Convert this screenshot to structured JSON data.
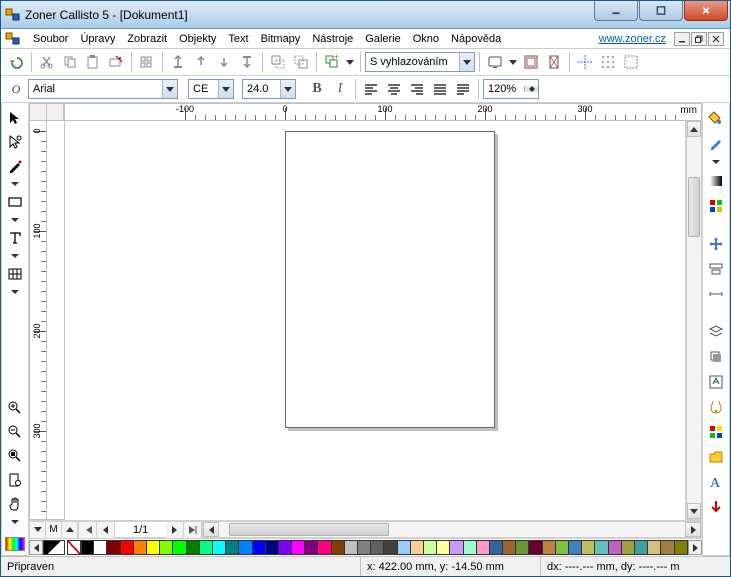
{
  "title": "Zoner Callisto 5 - [Dokument1]",
  "url": "www.zoner.cz",
  "menus": [
    "Soubor",
    "Úpravy",
    "Zobrazit",
    "Objekty",
    "Text",
    "Bitmapy",
    "Nástroje",
    "Galerie",
    "Okno",
    "Nápověda"
  ],
  "toolbar2": {
    "smoothing": "S vyhlazováním"
  },
  "formatbar": {
    "font_icon": "O",
    "font": "Arial",
    "lang": "CE",
    "size": "24.0",
    "bold": "B",
    "italic": "I",
    "zoom": "120%"
  },
  "ruler": {
    "unit": "mm",
    "h_ticks": [
      -100,
      0,
      100,
      200,
      300
    ],
    "v_ticks": [
      0,
      100,
      200,
      300
    ]
  },
  "pages": {
    "label": "1/1",
    "layer": "M"
  },
  "status": {
    "ready": "Připraven",
    "coords": "x: 422.00 mm, y: -14.50 mm",
    "delta": "dx: ----.--- mm, dy: ----.--- m"
  },
  "colors": [
    "#000000",
    "#ffffff",
    "#800000",
    "#ff0000",
    "#ff8000",
    "#ffff00",
    "#80ff00",
    "#00ff00",
    "#008000",
    "#00ff80",
    "#00ffff",
    "#008080",
    "#0080ff",
    "#0000ff",
    "#000080",
    "#8000ff",
    "#ff00ff",
    "#800080",
    "#ff0080",
    "#804000",
    "#c0c0c0",
    "#808080",
    "#606060",
    "#404040",
    "#99ccff",
    "#ffcc99",
    "#ccff99",
    "#ffff99",
    "#cc99ff",
    "#99ffcc",
    "#ff99cc",
    "#336699",
    "#996633",
    "#669933",
    "#660033",
    "#c08040",
    "#80c040",
    "#4080c0",
    "#c0c060",
    "#60c0c0",
    "#c060c0",
    "#a0a040",
    "#40a0a0",
    "#d4c080",
    "#a08040",
    "#808000"
  ],
  "well_colors": [
    "#000000",
    "#ffffff"
  ]
}
